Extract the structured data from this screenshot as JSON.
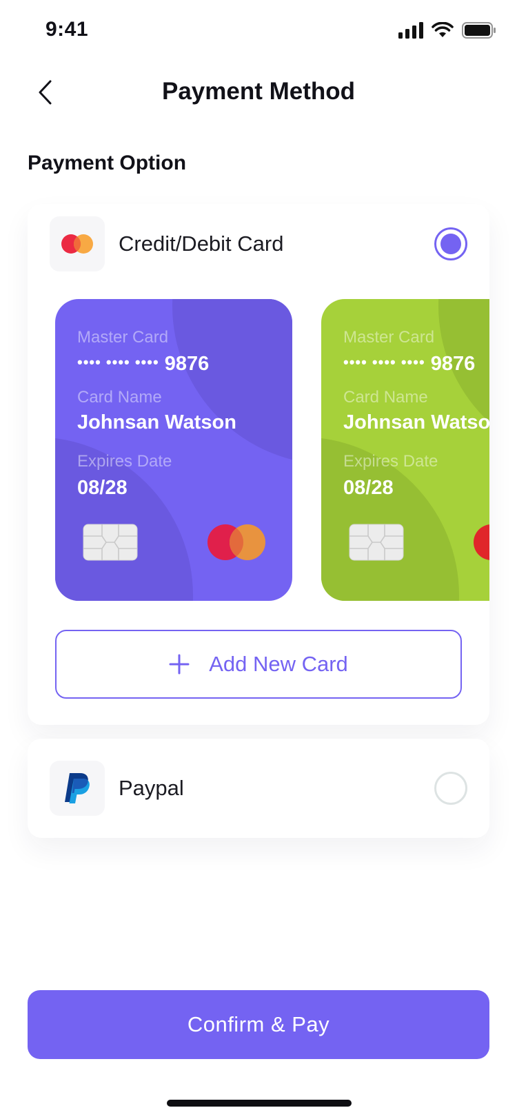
{
  "status_bar": {
    "time": "9:41"
  },
  "header": {
    "title": "Payment Method",
    "back_icon": "chevron-left-icon"
  },
  "section": {
    "title": "Payment Option"
  },
  "options": {
    "card": {
      "label": "Credit/Debit Card",
      "selected": true,
      "icon": "mastercard-icon"
    },
    "paypal": {
      "label": "Paypal",
      "selected": false,
      "icon": "paypal-icon"
    }
  },
  "cards": [
    {
      "type": "Master Card",
      "masked": "•••• ••••  ••••",
      "last4": "9876",
      "name_caption": "Card Name",
      "holder": "Johnsan Watson",
      "expiry_caption": "Expires Date",
      "expiry": "08/28",
      "color": "#7463f2"
    },
    {
      "type": "Master Card",
      "masked": "•••• ••••  ••••",
      "last4": "9876",
      "name_caption": "Card Name",
      "holder": "Johnsan Watson",
      "expiry_caption": "Expires Date",
      "expiry": "08/28",
      "color": "#a6d13a"
    }
  ],
  "add_card": {
    "label": "Add New Card",
    "icon": "plus-icon"
  },
  "confirm": {
    "label": "Confirm & Pay"
  },
  "colors": {
    "accent": "#7463f2",
    "green_card": "#a6d13a",
    "text": "#111118"
  }
}
